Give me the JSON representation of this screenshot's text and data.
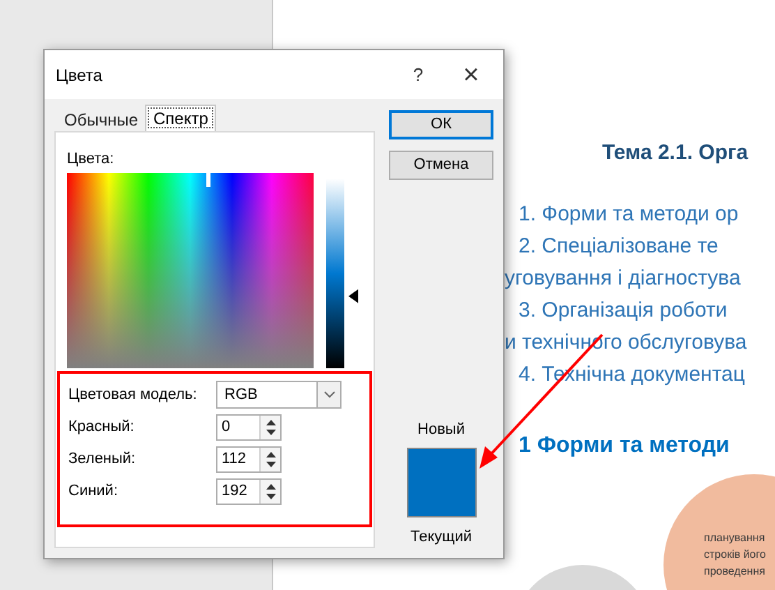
{
  "document": {
    "title": "Тема 2.1. Орга",
    "lines": [
      {
        "kind": "item",
        "text": "1. Форми та методи ор"
      },
      {
        "kind": "item",
        "text": "2.  Спеціалізоване  те"
      },
      {
        "kind": "continuation",
        "text": "уговування і діагностува"
      },
      {
        "kind": "item",
        "text": "3. Організація роботи"
      },
      {
        "kind": "continuation",
        "text": "и технічного обслуговува"
      },
      {
        "kind": "item",
        "text": "4. Технічна документац"
      }
    ],
    "heading": "1  Форми та методи",
    "circles": [
      {
        "color": "#d9d9d9"
      },
      {
        "color": "#f1bb9e",
        "lines": [
          "планування",
          "строків його",
          "проведення"
        ]
      }
    ]
  },
  "dialog": {
    "title": "Цвета",
    "help": "?",
    "close": "×",
    "tabs": [
      {
        "label": "Обычные",
        "selected": false
      },
      {
        "label": "Спектр",
        "selected": true
      }
    ],
    "colors_label": "Цвета:",
    "luminance": {
      "level": 0.38
    },
    "color_model": {
      "label": "Цветовая модель:",
      "value": "RGB"
    },
    "channels": [
      {
        "label": "Красный:",
        "value": "0"
      },
      {
        "label": "Зеленый:",
        "value": "112"
      },
      {
        "label": "Синий:",
        "value": "192"
      }
    ],
    "buttons": [
      {
        "label": "ОК",
        "default": true
      },
      {
        "label": "Отмена",
        "default": false
      }
    ],
    "new_label": "Новый",
    "current_label": "Текущий"
  }
}
